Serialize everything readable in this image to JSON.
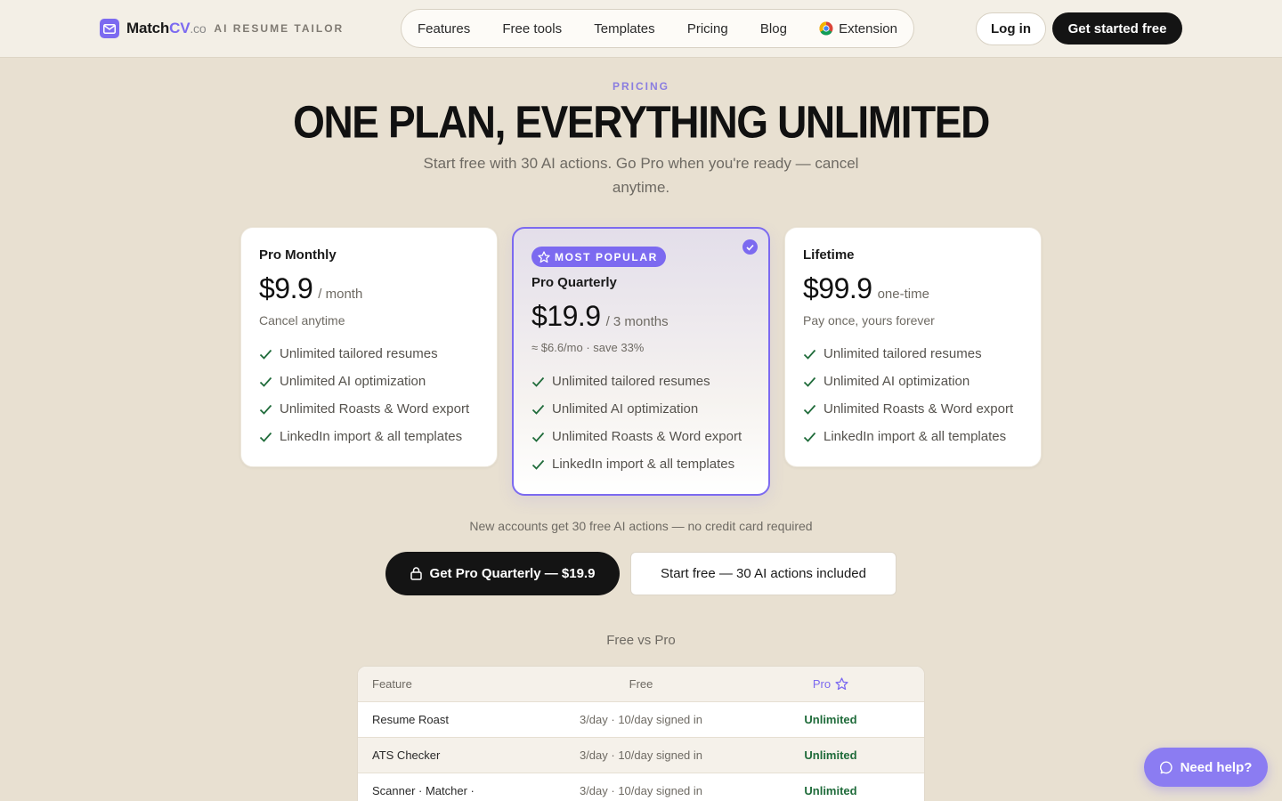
{
  "brand": {
    "name_main": "Match",
    "name_accent": "CV",
    "name_suffix": ".co",
    "tagline": "AI RESUME TAILOR"
  },
  "nav": {
    "items": [
      "Features",
      "Free tools",
      "Templates",
      "Pricing",
      "Blog",
      "Extension"
    ]
  },
  "header": {
    "login_label": "Log in",
    "cta_label": "Get started free"
  },
  "hero": {
    "eyebrow": "PRICING",
    "title": "ONE PLAN, EVERYTHING UNLIMITED",
    "subtitle": "Start free with 30 AI actions. Go Pro when you're ready — cancel anytime."
  },
  "plans": [
    {
      "name": "Pro Monthly",
      "price": "$9.9",
      "period": "/ month",
      "note": "Cancel anytime",
      "features": [
        "Unlimited tailored resumes",
        "Unlimited AI optimization",
        "Unlimited Roasts & Word export",
        "LinkedIn import & all templates"
      ]
    },
    {
      "badge": "MOST POPULAR",
      "name": "Pro Quarterly",
      "price": "$19.9",
      "period": "/ 3 months",
      "note": "≈ $6.6/mo · save 33%",
      "features": [
        "Unlimited tailored resumes",
        "Unlimited AI optimization",
        "Unlimited Roasts & Word export",
        "LinkedIn import & all templates"
      ]
    },
    {
      "name": "Lifetime",
      "price": "$99.9",
      "period": "one-time",
      "note": "Pay once, yours forever",
      "features": [
        "Unlimited tailored resumes",
        "Unlimited AI optimization",
        "Unlimited Roasts & Word export",
        "LinkedIn import & all templates"
      ]
    }
  ],
  "cta": {
    "note": "New accounts get 30 free AI actions — no credit card required",
    "primary_label": "Get Pro Quarterly — $19.9",
    "secondary_label": "Start free — 30 AI actions included"
  },
  "compare": {
    "title": "Free vs Pro",
    "headers": {
      "feature": "Feature",
      "free": "Free",
      "pro": "Pro"
    },
    "rows": [
      {
        "feature": "Resume Roast",
        "free": "3/day · 10/day signed in",
        "pro": "Unlimited"
      },
      {
        "feature": "ATS Checker",
        "free": "3/day · 10/day signed in",
        "pro": "Unlimited"
      },
      {
        "feature": "Scanner · Matcher ·",
        "free": "3/day · 10/day signed in",
        "pro": "Unlimited"
      }
    ]
  },
  "help": {
    "label": "Need help?"
  },
  "colors": {
    "accent": "#7c6af0",
    "background": "#e8e0d1",
    "header_bg": "#f3efe6",
    "dark_button": "#141414",
    "check_green": "#1f6b3a"
  },
  "icons": {
    "logo": "mail-icon",
    "extension": "chrome-icon",
    "popular": "star-icon",
    "selected": "check-circle-icon",
    "feature": "check-icon",
    "pro_button": "lock-icon",
    "pro_column": "star-icon",
    "help": "chat-bubble-icon"
  }
}
